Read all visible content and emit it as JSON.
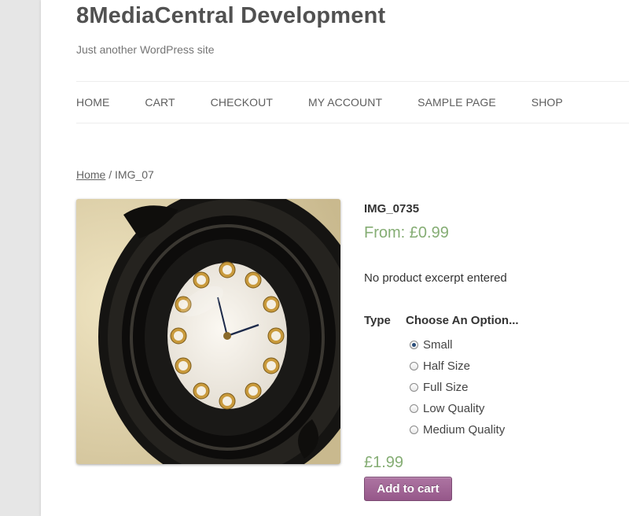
{
  "site": {
    "title": "8MediaCentral Development",
    "description": "Just another WordPress site"
  },
  "nav": {
    "items": [
      {
        "label": "HOME"
      },
      {
        "label": "CART"
      },
      {
        "label": "CHECKOUT"
      },
      {
        "label": "MY ACCOUNT"
      },
      {
        "label": "SAMPLE PAGE"
      },
      {
        "label": "SHOP"
      }
    ]
  },
  "breadcrumb": {
    "home": "Home",
    "separator": " / ",
    "current": "IMG_07"
  },
  "product": {
    "image_icon": "wall-clock-photo",
    "title": "IMG_0735",
    "price_range": "From: £0.99",
    "excerpt": "No product excerpt entered",
    "variation_label": "Type",
    "variation_placeholder": "Choose An Option...",
    "options": [
      {
        "label": "Small",
        "checked": true
      },
      {
        "label": "Half Size",
        "checked": false
      },
      {
        "label": "Full Size",
        "checked": false
      },
      {
        "label": "Low Quality",
        "checked": false
      },
      {
        "label": "Medium Quality",
        "checked": false
      }
    ],
    "price": "£1.99",
    "add_to_cart": "Add to cart"
  },
  "colors": {
    "price_green": "#85ad74",
    "button_purple": "#96588a",
    "page_bg": "#e6e6e6"
  }
}
